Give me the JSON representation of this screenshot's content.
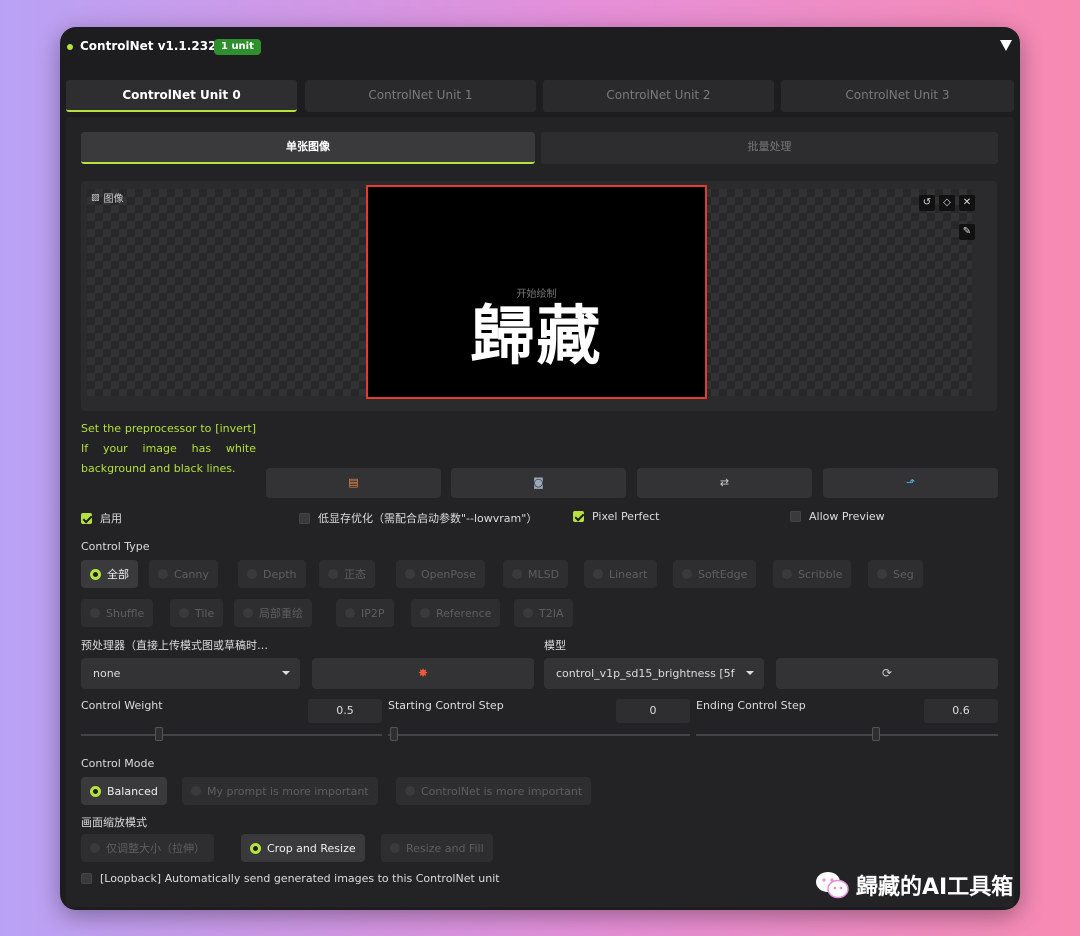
{
  "header": {
    "title": "ControlNet v1.1.232",
    "badge": "1 unit"
  },
  "unit_tabs": [
    "ControlNet Unit 0",
    "ControlNet Unit 1",
    "ControlNet Unit 2",
    "ControlNet Unit 3"
  ],
  "mode_tabs": [
    "单张图像",
    "批量处理"
  ],
  "image": {
    "label": "图像",
    "hint": "开始绘制",
    "content": "歸藏"
  },
  "note": "Set the preprocessor to [invert] If your image has white background and black lines.",
  "checks": {
    "enable": "启用",
    "lowvram": "低显存优化（需配合启动参数\"--lowvram\"）",
    "pixel_perfect": "Pixel Perfect",
    "allow_preview": "Allow Preview"
  },
  "control_type": {
    "label": "Control Type",
    "options": [
      "全部",
      "Canny",
      "Depth",
      "正态",
      "OpenPose",
      "MLSD",
      "Lineart",
      "SoftEdge",
      "Scribble",
      "Seg",
      "Shuffle",
      "Tile",
      "局部重绘",
      "IP2P",
      "Reference",
      "T2IA"
    ],
    "selected": "全部"
  },
  "preprocessor": {
    "label": "预处理器（直接上传模式图或草稿时…",
    "value": "none"
  },
  "model": {
    "label": "模型",
    "value": "control_v1p_sd15_brightness [5f"
  },
  "sliders": {
    "weight": {
      "label": "Control Weight",
      "value": "0.5"
    },
    "start": {
      "label": "Starting Control Step",
      "value": "0"
    },
    "end": {
      "label": "Ending Control Step",
      "value": "0.6"
    }
  },
  "control_mode": {
    "label": "Control Mode",
    "options": [
      "Balanced",
      "My prompt is more important",
      "ControlNet is more important"
    ],
    "selected": "Balanced"
  },
  "resize_mode": {
    "label": "画面缩放模式",
    "options": [
      "仅调整大小（拉伸）",
      "Crop and Resize",
      "Resize and Fill"
    ],
    "selected": "Crop and Resize"
  },
  "loopback": "[Loopback] Automatically send generated images to this ControlNet unit",
  "watermark": "歸藏的AI工具箱",
  "colors": {
    "accent": "#b5e23c",
    "badge": "#2f8f2f",
    "canvas_border": "#e53a2e"
  }
}
